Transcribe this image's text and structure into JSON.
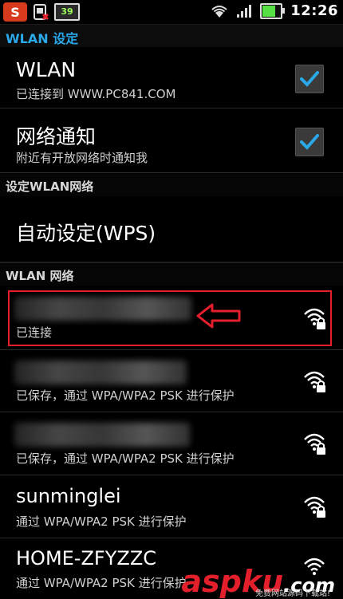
{
  "statusbar": {
    "battery_level": "39",
    "time": "12:26"
  },
  "header": {
    "title": "WLAN 设定"
  },
  "toggles": [
    {
      "primary": "WLAN",
      "secondary": "已连接到 WWW.PC841.COM",
      "checked": true
    },
    {
      "primary": "网络通知",
      "secondary": "附近有开放网络时通知我",
      "checked": true
    }
  ],
  "sections": {
    "setup": "设定WLAN网络",
    "networks": "WLAN 网络"
  },
  "wps": {
    "label": "自动设定(WPS)"
  },
  "networks": [
    {
      "ssid": "",
      "status": "已连接"
    },
    {
      "ssid": "",
      "status": "已保存，通过 WPA/WPA2 PSK 进行保护"
    },
    {
      "ssid": "",
      "status": "已保存，通过 WPA/WPA2 PSK 进行保护"
    },
    {
      "ssid": "sunminglei",
      "status": "通过 WPA/WPA2 PSK 进行保护"
    },
    {
      "ssid": "HOME-ZFYZZC",
      "status": "通过 WPA/WPA2 PSK 进行保护"
    }
  ],
  "watermark": {
    "brand": "aspku",
    "suffix": ".com",
    "tagline": "免费网站源码下载站!"
  },
  "colors": {
    "accent": "#2aa8e8",
    "highlight": "#e21f2b"
  },
  "icons": {
    "wifi": "wifi-secured-icon",
    "check": "checkmark-icon",
    "arrow": "left-arrow-annotation"
  }
}
